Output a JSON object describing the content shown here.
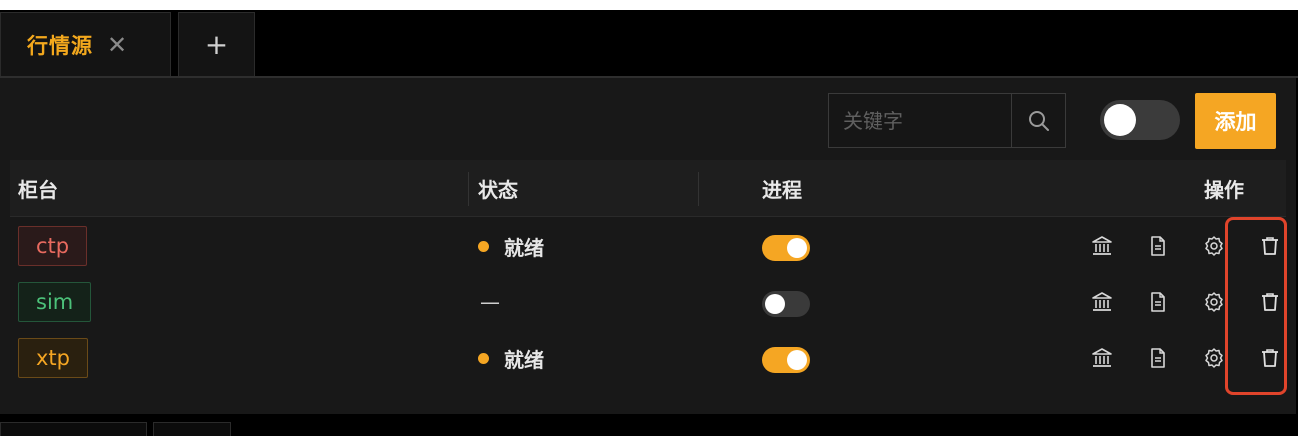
{
  "tabs": [
    {
      "label": "行情源",
      "close": "✕"
    }
  ],
  "add_tab": "+",
  "toolbar": {
    "search_placeholder": "关键字",
    "add_label": "添加"
  },
  "table": {
    "headers": {
      "counter": "柜台",
      "status": "状态",
      "process": "进程",
      "actions": "操作"
    },
    "rows": [
      {
        "counter": "ctp",
        "tag_color": "#e86a5f",
        "tag_bg": "#2a1a1a",
        "tag_border": "#6a2f2a",
        "status": "就绪",
        "status_dot": true,
        "process_on": true
      },
      {
        "counter": "sim",
        "tag_color": "#4cc27a",
        "tag_bg": "#142219",
        "tag_border": "#24563a",
        "status": "—",
        "status_dot": false,
        "process_on": false
      },
      {
        "counter": "xtp",
        "tag_color": "#f5a623",
        "tag_bg": "#2a200f",
        "tag_border": "#6a4a18",
        "status": "就绪",
        "status_dot": true,
        "process_on": true
      }
    ]
  },
  "colors": {
    "accent": "#f5a623",
    "highlight": "#e0442b"
  },
  "icons": [
    "bank-icon",
    "document-icon",
    "gear-icon",
    "trash-icon"
  ]
}
